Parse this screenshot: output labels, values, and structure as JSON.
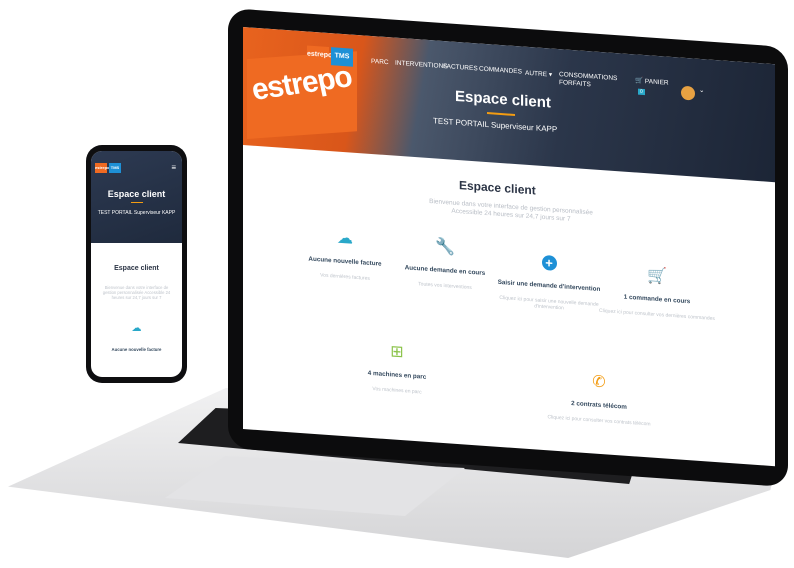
{
  "nav": {
    "logo_left": "estrepo",
    "logo_right": "TMS",
    "items": [
      "PARC",
      "INTERVENTIONS",
      "FACTURES",
      "COMMANDES",
      "AUTRE ▾",
      "CONSOMMATIONS FORFAITS"
    ],
    "cart_label": "PANIER",
    "cart_count": "0",
    "user_chevron": "⌄"
  },
  "hero": {
    "sign_text": "estrepo",
    "title": "Espace client",
    "subtitle": "TEST PORTAIL Superviseur KAPP"
  },
  "main": {
    "title": "Espace client",
    "subtitle": "Bienvenue dans votre interface de gestion personnalisée Accessible 24 heures sur 24,7 jours sur 7",
    "cards": [
      {
        "icon": "cloud-icon",
        "glyph": "☁",
        "color": "#29a8c9",
        "label": "Aucune nouvelle facture",
        "desc": "Vos dernières factures"
      },
      {
        "icon": "wrench-icon",
        "glyph": "🔧",
        "color": "#29a8c9",
        "label": "Aucune demande en cours",
        "desc": "Toutes vos interventions"
      },
      {
        "icon": "plus-icon",
        "glyph": "+",
        "color": "#1e90d6",
        "label": "Saisir une demande d'intervention",
        "desc": "Cliquez ici pour saisir une nouvelle demande d'intervention"
      },
      {
        "icon": "cart-icon",
        "glyph": "🛒",
        "color": "#b31fcc",
        "label": "1 commande en cours",
        "desc": "Cliquez ici pour consulter vos dernières commandes"
      },
      {
        "icon": "network-icon",
        "glyph": "⊞",
        "color": "#8bc34a",
        "label": "4 machines en parc",
        "desc": "Vos machines en parc"
      },
      {
        "icon": "phone-icon",
        "glyph": "✆",
        "color": "#f39c12",
        "label": "2 contrats télécom",
        "desc": "Cliquez ici pour consulter vos contrats télécom"
      }
    ]
  },
  "phone": {
    "title": "Espace client",
    "subtitle": "TEST PORTAIL Superviseur KAPP",
    "section_title": "Espace client",
    "section_desc": "Bienvenue dans votre interface de gestion personnalisée Accessible 24 heures sur 24,7 jours sur 7",
    "card_label": "Aucune nouvelle facture",
    "menu_glyph": "≡"
  }
}
